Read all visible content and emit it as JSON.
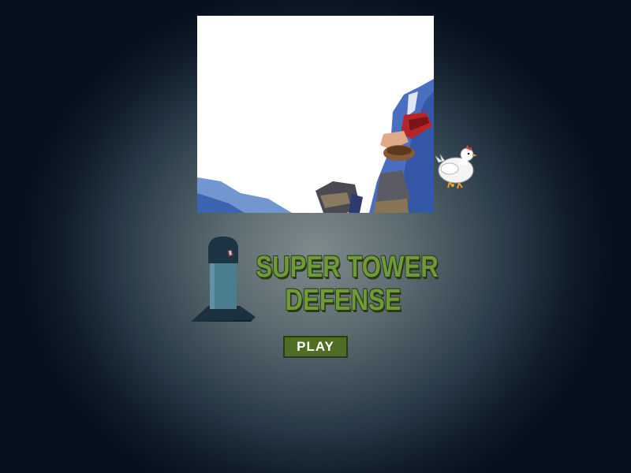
{
  "title": {
    "line1": "SUPER TOWER",
    "line2": "DEFENSE"
  },
  "menu": {
    "play_label": "PLAY"
  },
  "colors": {
    "title_green": "#6f9a3a",
    "button_green": "#4d6e24",
    "tower_body": "#4a7d90",
    "background_center": "#7f8b8c",
    "background_edge": "#06101c"
  },
  "sprites": {
    "splash_art": "hero-with-sword-art",
    "mascot": "chicken-sprite",
    "logo": "tower-icon"
  }
}
